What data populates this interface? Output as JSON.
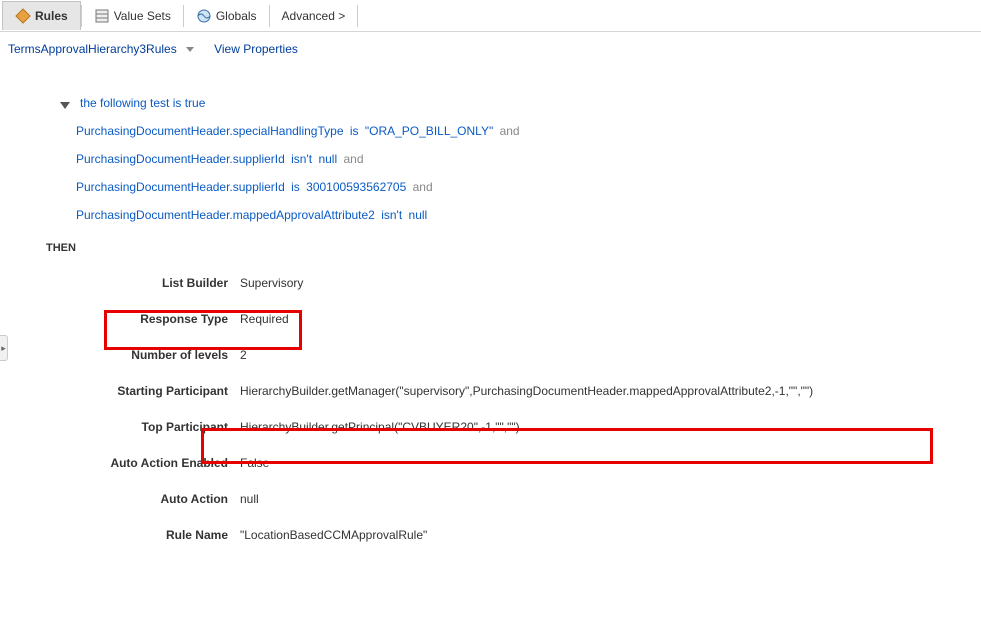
{
  "tabs": {
    "rules": "Rules",
    "valueSets": "Value Sets",
    "globals": "Globals",
    "advanced": "Advanced >"
  },
  "header": {
    "ruleSetName": "TermsApprovalHierarchy3Rules",
    "viewProps": "View Properties"
  },
  "testHeader": "the following test is true",
  "conditions": [
    {
      "field": "PurchasingDocumentHeader.specialHandlingType",
      "op": "is",
      "val": "\"ORA_PO_BILL_ONLY\"",
      "and": true
    },
    {
      "field": "PurchasingDocumentHeader.supplierId",
      "op": "isn't",
      "val": "null",
      "and": true
    },
    {
      "field": "PurchasingDocumentHeader.supplierId",
      "op": "is",
      "val": "300100593562705",
      "and": true
    },
    {
      "field": "PurchasingDocumentHeader.mappedApprovalAttribute2",
      "op": "isn't",
      "val": "null",
      "and": false
    }
  ],
  "thenLabel": "THEN",
  "props": {
    "listBuilder": {
      "label": "List Builder",
      "value": "Supervisory"
    },
    "responseType": {
      "label": "Response Type",
      "value": "Required"
    },
    "numLevels": {
      "label": "Number of levels",
      "value": "2"
    },
    "startingParticipant": {
      "label": "Starting Participant",
      "value": "HierarchyBuilder.getManager(\"supervisory\",PurchasingDocumentHeader.mappedApprovalAttribute2,-1,\"\",\"\")"
    },
    "topParticipant": {
      "label": "Top Participant",
      "value": "HierarchyBuilder.getPrincipal(\"CVBUYER20\",-1,\"\",\"\")"
    },
    "autoActionEnabled": {
      "label": "Auto Action Enabled",
      "value": "False"
    },
    "autoAction": {
      "label": "Auto Action",
      "value": "null"
    },
    "ruleName": {
      "label": "Rule Name",
      "value": "\"LocationBasedCCMApprovalRule\""
    }
  }
}
